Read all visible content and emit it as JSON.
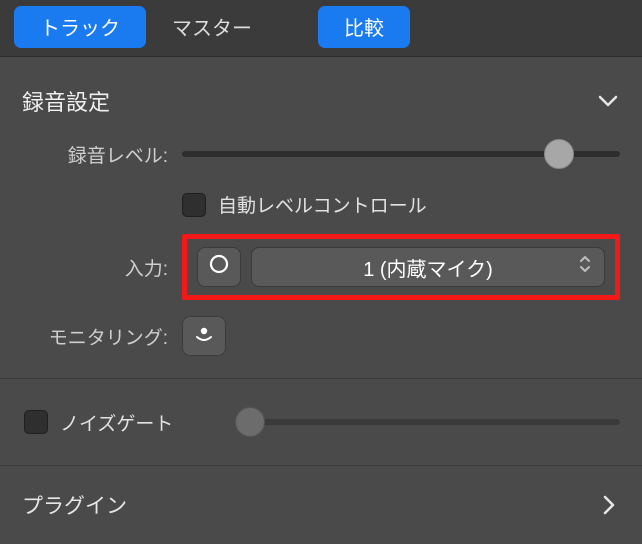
{
  "tabs": {
    "track": "トラック",
    "master": "マスター",
    "compare": "比較"
  },
  "recording": {
    "title": "録音設定",
    "level_label": "録音レベル:",
    "level_value": 0.86,
    "auto_level_label": "自動レベルコントロール",
    "auto_level_checked": false,
    "input_label": "入力:",
    "input_selected": "1 (内蔵マイク)",
    "monitoring_label": "モニタリング:"
  },
  "noise_gate": {
    "label": "ノイズゲート",
    "checked": false,
    "slider_value": 0.0
  },
  "plugin": {
    "label": "プラグイン"
  },
  "colors": {
    "accent": "#1a7af0",
    "highlight": "#f41919",
    "panel": "#4a4a4a"
  }
}
